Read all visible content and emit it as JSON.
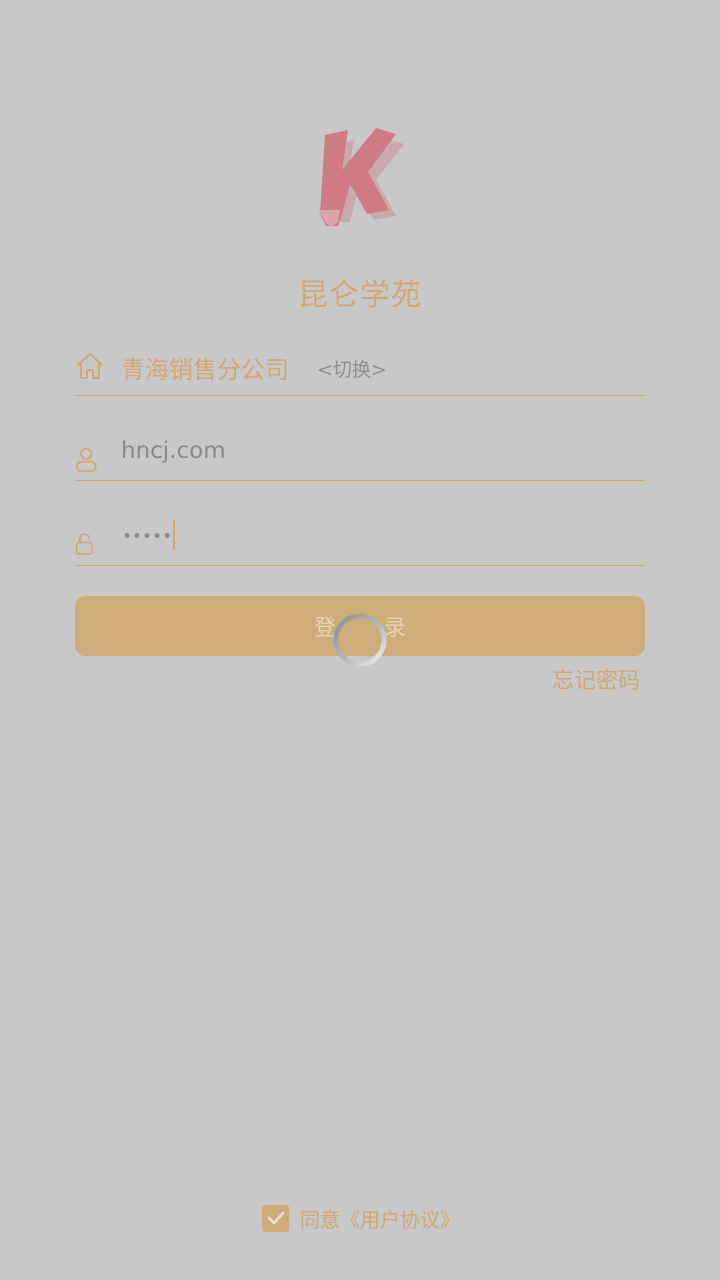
{
  "app": {
    "title": "昆仑学苑"
  },
  "company": {
    "name": "青海销售分公司",
    "switch_label": "<切换>"
  },
  "username": {
    "value": "hncj.com"
  },
  "password": {
    "masked_value": "•••••"
  },
  "login": {
    "label": "登录"
  },
  "forgot": {
    "label": "忘记密码"
  },
  "agreement": {
    "label": "同意《用户协议》",
    "checked": true
  },
  "icons": {
    "company": "home-icon",
    "username": "user-icon",
    "password": "unlock-icon",
    "agreement": "checkmark-icon",
    "loading": "loading-spinner-icon"
  },
  "colors": {
    "background": "#c8c8c8",
    "accent": "#d2a873",
    "button": "#cfad7b",
    "logo": "#cf7b84"
  }
}
